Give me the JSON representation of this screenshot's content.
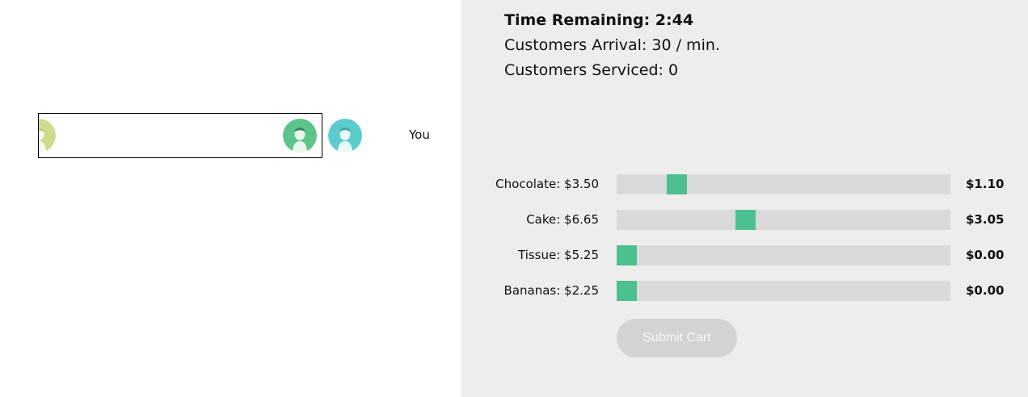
{
  "stats": {
    "time_remaining": "Time Remaining: 2:44",
    "arrival": "Customers Arrival: 30 / min.",
    "serviced": "Customers Serviced: 0"
  },
  "queue": {
    "you_label": "You",
    "avatar_colors": {
      "partial": "#cfdc8c",
      "queued": "#5cc48a",
      "serving": "#5ccbcc"
    }
  },
  "products": [
    {
      "label": "Chocolate: $3.50",
      "amount": "$1.10",
      "level": 0.16
    },
    {
      "label": "Cake: $6.65",
      "amount": "$3.05",
      "level": 0.38
    },
    {
      "label": "Tissue: $5.25",
      "amount": "$0.00",
      "level": 0.0
    },
    {
      "label": "Bananas: $2.25",
      "amount": "$0.00",
      "level": 0.0
    }
  ],
  "submit_label": "Submit Cart",
  "colors": {
    "accent": "#4dc08f",
    "track": "#dadada",
    "panel_bg": "#ededed",
    "button_disabled": "#d3d3d3"
  }
}
